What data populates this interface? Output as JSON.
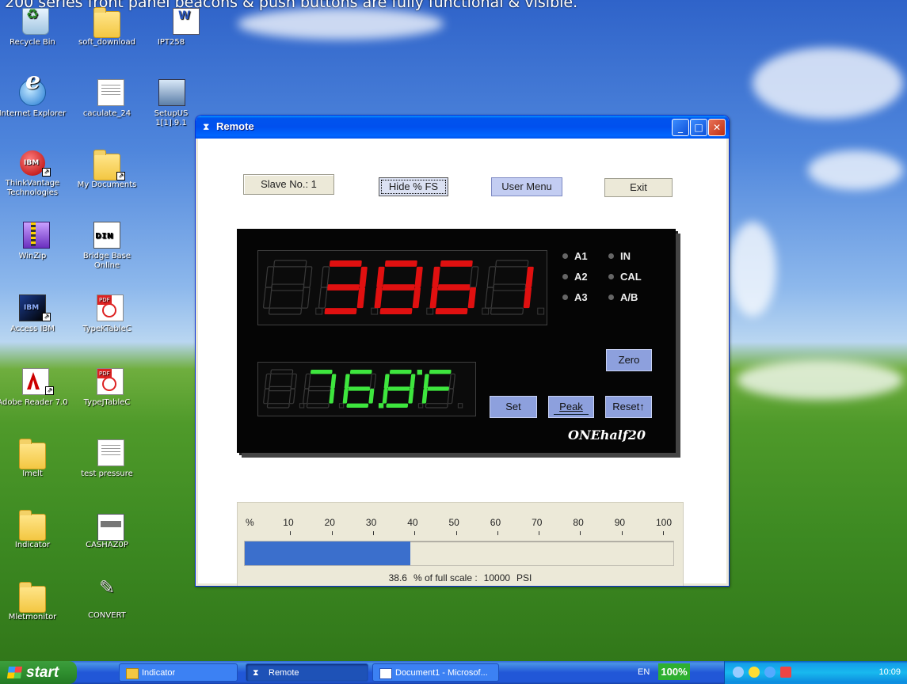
{
  "banner": "200 series front panel beacons & push buttons are fully functional & visible.",
  "desktop_icons": [
    {
      "label": "Recycle Bin",
      "icon": "recycle-bin-icon"
    },
    {
      "label": "soft_download",
      "icon": "folder-icon"
    },
    {
      "label": "IPT258",
      "icon": "word-document-icon"
    },
    {
      "label": "Internet Explorer",
      "icon": "internet-explorer-icon"
    },
    {
      "label": "caculate_24",
      "icon": "text-document-icon"
    },
    {
      "label": "SetupUS 1[1].9.1",
      "icon": "setup-icon"
    },
    {
      "label": "ThinkVantage Technologies",
      "icon": "thinkvantage-icon"
    },
    {
      "label": "My Documents",
      "icon": "my-documents-icon"
    },
    {
      "label": "WinZip",
      "icon": "winzip-icon"
    },
    {
      "label": "Bridge Base Online",
      "icon": "bridge-base-icon"
    },
    {
      "label": "Access IBM",
      "icon": "access-ibm-icon"
    },
    {
      "label": "TypeKTableC",
      "icon": "pdf-icon"
    },
    {
      "label": "Adobe Reader 7.0",
      "icon": "adobe-reader-icon"
    },
    {
      "label": "TypeJTableC",
      "icon": "pdf-icon"
    },
    {
      "label": "Imelt",
      "icon": "folder-icon"
    },
    {
      "label": "test pressure",
      "icon": "text-document-icon"
    },
    {
      "label": "Indicator",
      "icon": "folder-icon"
    },
    {
      "label": "CASHAZ0P",
      "icon": "application-icon"
    },
    {
      "label": "Mletmonitor",
      "icon": "folder-icon"
    },
    {
      "label": "CONVERT",
      "icon": "convert-icon"
    }
  ],
  "window": {
    "title": "Remote",
    "controls": {
      "minimize": "_",
      "maximize": "□",
      "close": "✕"
    },
    "slave_label": "Slave No.:  1",
    "hide_fs_button": "Hide % FS",
    "user_menu_button": "User Menu",
    "exit_button": "Exit",
    "meter": {
      "primary_display": "3861",
      "primary_color": "#e01010",
      "secondary_display": "76.8°F",
      "secondary_color": "#3ee63e",
      "indicators_left": [
        "A1",
        "A2",
        "A3"
      ],
      "indicators_right": [
        "IN",
        "CAL",
        "A/B"
      ],
      "zero_button": "Zero",
      "set_button": "Set",
      "peak_button": "Peak",
      "reset_button": "Reset",
      "brand": "ONEhalf20"
    },
    "scale": {
      "ticks": [
        "%",
        "10",
        "20",
        "30",
        "40",
        "50",
        "60",
        "70",
        "80",
        "90",
        "100"
      ],
      "percent": 38.6,
      "percent_text": "38.6",
      "caption_mid": "% of full scale :",
      "full_scale": "10000",
      "unit": "PSI",
      "bar_color": "#3b6fcc"
    }
  },
  "taskbar": {
    "start_label": "start",
    "items": [
      {
        "label": "Indicator",
        "icon": "folder-icon",
        "active": false
      },
      {
        "label": "Remote",
        "icon": "remote-app-icon",
        "active": true
      },
      {
        "label": "Document1 - Microsof...",
        "icon": "word-icon",
        "active": false
      }
    ],
    "language": "EN",
    "zoom": "100%",
    "clock": "10:09"
  }
}
